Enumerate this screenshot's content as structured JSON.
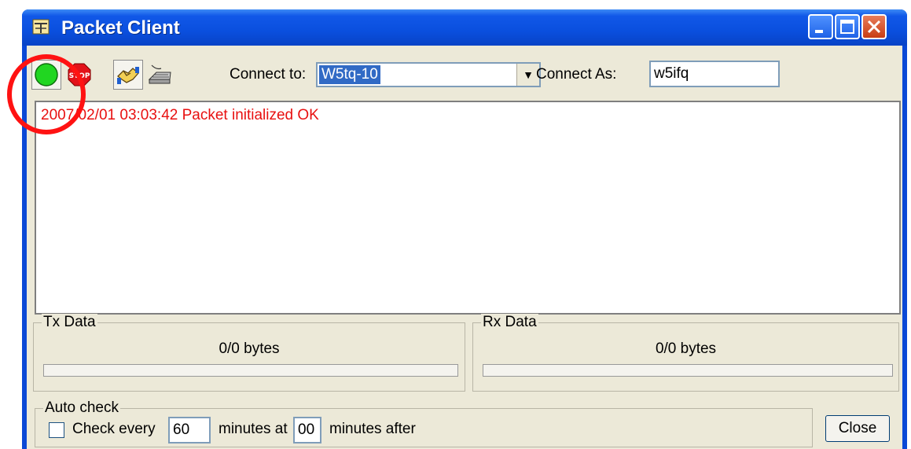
{
  "window": {
    "title": "Packet Client"
  },
  "toolbar": {
    "connect_icon": "green-circle-icon",
    "stop_icon": "stop-sign-icon",
    "stop_text": "STOP",
    "handshake_icon": "handshake-icon",
    "keyboard_icon": "keyboard-icon",
    "connect_to_label": "Connect to:",
    "connect_to_value": "W5tq-10",
    "connect_as_label": "Connect As:",
    "connect_as_value": "w5ifq"
  },
  "log": {
    "lines": [
      "2007/02/01 03:03:42 Packet initialized OK"
    ]
  },
  "tx": {
    "label": "Tx Data",
    "bytes": "0/0 bytes",
    "progress": 0
  },
  "rx": {
    "label": "Rx Data",
    "bytes": "0/0 bytes",
    "progress": 0
  },
  "autocheck": {
    "label": "Auto check",
    "checked": false,
    "check_every_label": "Check every",
    "minutes_value": "60",
    "minutes_at_label": "minutes at",
    "after_value": "00",
    "after_label": "minutes after"
  },
  "buttons": {
    "close": "Close"
  },
  "colors": {
    "titlebar": "#0a4fde",
    "log_text": "#e81010",
    "annotation": "#ff1212",
    "connect_green": "#21d621"
  }
}
